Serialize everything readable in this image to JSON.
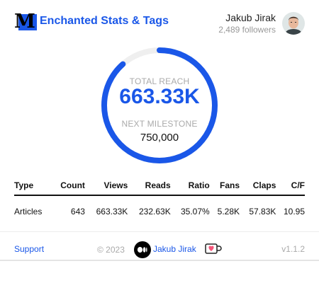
{
  "header": {
    "app_title": "Enchanted Stats & Tags",
    "user_name": "Jakub Jirak",
    "followers": "2,489 followers"
  },
  "reach": {
    "total_label": "TOTAL REACH",
    "total_value": "663.33K",
    "milestone_label": "NEXT MILESTONE",
    "milestone_value": "750,000",
    "progress_fraction": 0.8844
  },
  "stats_table": {
    "columns": [
      "Type",
      "Count",
      "Views",
      "Reads",
      "Ratio",
      "Fans",
      "Claps",
      "C/F"
    ],
    "rows": [
      [
        "Articles",
        "643",
        "663.33K",
        "232.63K",
        "35.07%",
        "5.28K",
        "57.83K",
        "10.95"
      ]
    ]
  },
  "footer": {
    "support": "Support",
    "copyright": "© 2023",
    "author": "Jakub Jirak",
    "version": "v1.1.2"
  },
  "icons": {
    "logo": "medium-logo-icon",
    "author": "medium-author-icon",
    "coffee": "coffee-heart-icon"
  },
  "colors": {
    "accent": "#1a57e8",
    "ring_track": "#efefef",
    "muted": "#aaaaaa"
  }
}
